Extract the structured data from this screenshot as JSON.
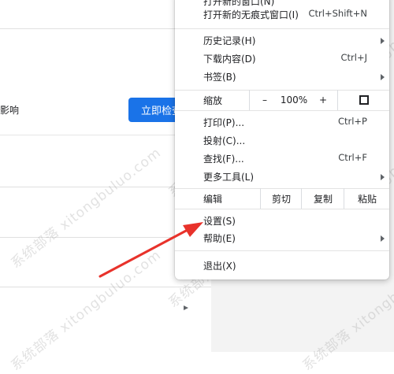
{
  "background": {
    "partial_text": "影响",
    "check_button": "立即检查"
  },
  "menu": {
    "top_partial_label": "打开新的窗口(N)",
    "incognito": {
      "label": "打开新的无痕式窗口(I)",
      "shortcut": "Ctrl+Shift+N"
    },
    "history": {
      "label": "历史记录(H)"
    },
    "downloads": {
      "label": "下载内容(D)",
      "shortcut": "Ctrl+J"
    },
    "bookmarks": {
      "label": "书签(B)"
    },
    "zoom": {
      "label": "缩放",
      "minus": "–",
      "value": "100%",
      "plus": "+"
    },
    "print": {
      "label": "打印(P)...",
      "shortcut": "Ctrl+P"
    },
    "cast": {
      "label": "投射(C)..."
    },
    "find": {
      "label": "查找(F)...",
      "shortcut": "Ctrl+F"
    },
    "more_tools": {
      "label": "更多工具(L)"
    },
    "edit": {
      "label": "编辑",
      "cut": "剪切",
      "copy": "复制",
      "paste": "粘贴"
    },
    "settings": {
      "label": "设置(S)"
    },
    "help": {
      "label": "帮助(E)"
    },
    "exit": {
      "label": "退出(X)"
    }
  },
  "watermark": "系统部落 xitongbuluo.com",
  "colors": {
    "accent": "#1a73e8",
    "arrow": "#e8322b"
  }
}
